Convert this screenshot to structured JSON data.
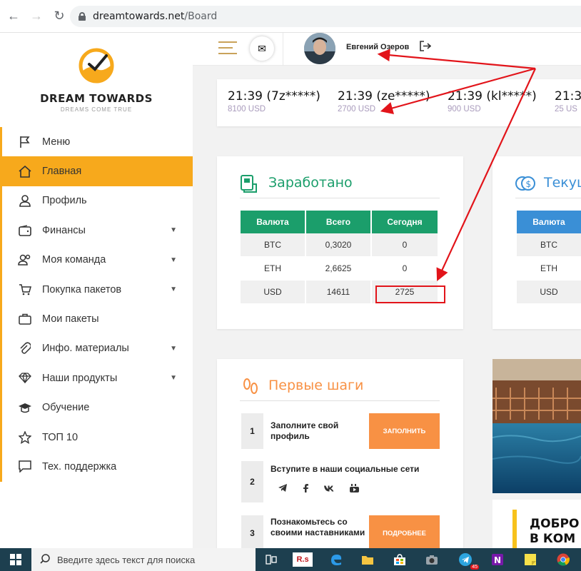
{
  "browser": {
    "url_host": "dreamtowards.net",
    "url_path": "/Board"
  },
  "sidebar": {
    "brand": "DREAM TOWARDS",
    "tagline": "DREAMS COME TRUE",
    "items": [
      {
        "label": "Меню"
      },
      {
        "label": "Главная"
      },
      {
        "label": "Профиль"
      },
      {
        "label": "Финансы"
      },
      {
        "label": "Моя команда"
      },
      {
        "label": "Покупка пакетов"
      },
      {
        "label": "Мои пакеты"
      },
      {
        "label": "Инфо. материалы"
      },
      {
        "label": "Наши продукты"
      },
      {
        "label": "Обучение"
      },
      {
        "label": "ТОП 10"
      },
      {
        "label": "Тех. поддержка"
      }
    ]
  },
  "header": {
    "username": "Евгений Озеров"
  },
  "ticker": [
    {
      "time": "21:39 (7z*****)",
      "amount": "8100 USD"
    },
    {
      "time": "21:39 (ze*****)",
      "amount": "2700 USD"
    },
    {
      "time": "21:39 (kl*****)",
      "amount": "900 USD"
    },
    {
      "time": "21:3",
      "amount": "25 US"
    }
  ],
  "earned": {
    "title": "Заработано",
    "headers": [
      "Валюта",
      "Всего",
      "Сегодня"
    ],
    "rows": [
      [
        "BTC",
        "0,3020",
        "0"
      ],
      [
        "ETH",
        "2,6625",
        "0"
      ],
      [
        "USD",
        "14611",
        "2725"
      ]
    ]
  },
  "current": {
    "title": "Текущ",
    "header": "Валюта",
    "rows": [
      "BTC",
      "ETH",
      "USD"
    ]
  },
  "first_steps": {
    "title": "Первые шаги",
    "steps": [
      {
        "num": "1",
        "text": "Заполните свой профиль",
        "button": "ЗАПОЛНИТЬ"
      },
      {
        "num": "2",
        "text": "Вступите в наши социальные сети"
      },
      {
        "num": "3",
        "text": "Познакомьтесь со своими наставниками",
        "button": "ПОДРОБНЕЕ"
      }
    ],
    "social": [
      "telegram-icon",
      "facebook-icon",
      "vk-icon",
      "youtube-icon"
    ]
  },
  "welcome": {
    "line1": "ДОБРО",
    "line2": "В КОМ"
  },
  "taskbar": {
    "search_placeholder": "Введите здесь текст для поиска",
    "badge": "45"
  },
  "colors": {
    "accent": "#f7a91c",
    "green": "#1b9e6b",
    "blue": "#3a8fd6",
    "orange": "#f89144",
    "annotation": "#e2141a"
  }
}
